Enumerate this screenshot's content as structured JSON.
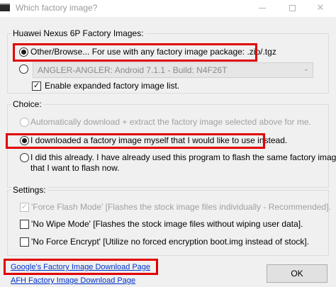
{
  "window": {
    "title": "Which factory image?"
  },
  "images_group": {
    "label": "Huawei Nexus 6P Factory Images:",
    "other_browse_label": "Other/Browse...  For use with any factory image package: .zip/.tgz",
    "combo_value": "ANGLER-ANGLER: Android 7.1.1 - Build: N4F26T",
    "expanded_list_label": "Enable expanded factory image list."
  },
  "choice_group": {
    "label": "Choice:",
    "auto_label": "Automatically download + extract the factory image selected above for me.",
    "downloaded_label": "I downloaded a factory image myself that I would like to use instead.",
    "already_line1": "I did this already. I have already used this program to flash the same factory image",
    "already_line2": "that I want to flash now."
  },
  "settings_group": {
    "label": "Settings:",
    "force_flash_label": "'Force Flash Mode' [Flashes the stock image files individually - Recommended].",
    "no_wipe_label": "'No Wipe Mode' [Flashes the stock image files without wiping user data].",
    "no_force_encrypt_label": "'No Force Encrypt' [Utilize no forced encryption boot.img instead of stock]."
  },
  "links": {
    "google_label": "Google's Factory Image Download Page",
    "afh_label": "AFH Factory Image Download Page"
  },
  "ok_label": "OK",
  "colors": {
    "highlight": "#e00000",
    "link": "#0033cc",
    "dialog_bg": "#f0f0f0"
  },
  "icons": {
    "check": "✓",
    "combo_arrow": "⌄"
  }
}
